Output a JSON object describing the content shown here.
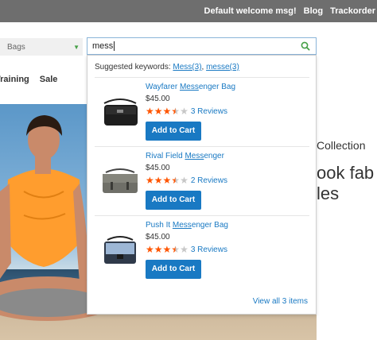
{
  "header": {
    "links": [
      "Default welcome msg!",
      "Blog",
      "Trackorder"
    ]
  },
  "search": {
    "category": "Bags",
    "query": "mess"
  },
  "nav": {
    "items": [
      "Training",
      "Sale"
    ]
  },
  "hero": {
    "line1": "Collection",
    "line2": "ook fab in",
    "line3": "les"
  },
  "dropdown": {
    "suggest_label": "Suggested keywords:",
    "keyword1": "Mess(3)",
    "separator": ",",
    "keyword2": "messe(3)",
    "products": [
      {
        "name_pre": "Wayfarer ",
        "name_match": "Mess",
        "name_post": "enger Bag",
        "price": "$45.00",
        "rating": 3.5,
        "reviews": "3 Reviews",
        "button": "Add to Cart"
      },
      {
        "name_pre": "Rival Field ",
        "name_match": "Mess",
        "name_post": "enger",
        "price": "$45.00",
        "rating": 3.5,
        "reviews": "2 Reviews",
        "button": "Add to Cart"
      },
      {
        "name_pre": "Push It ",
        "name_match": "Mess",
        "name_post": "enger Bag",
        "price": "$45.00",
        "rating": 3.5,
        "reviews": "3 Reviews",
        "button": "Add to Cart"
      }
    ],
    "view_all": "View all 3 items"
  },
  "colors": {
    "accent": "#1979c3",
    "star": "#ff5501",
    "topbar": "#6e6e6e"
  }
}
